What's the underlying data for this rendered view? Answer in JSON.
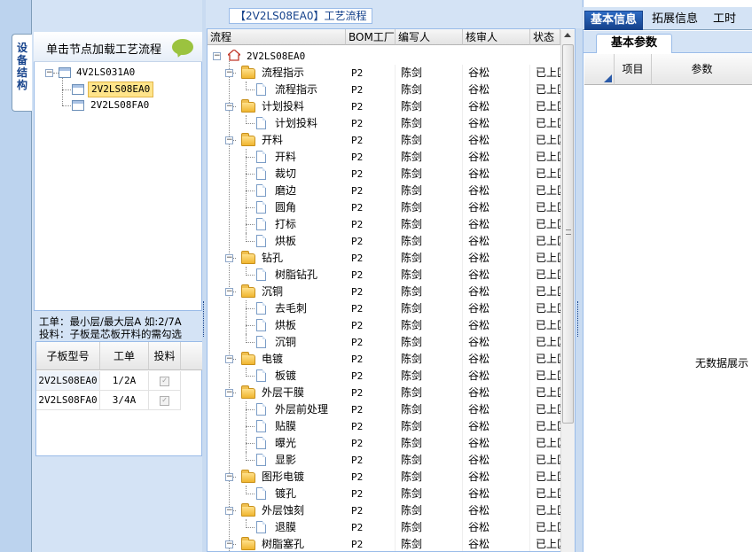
{
  "left_tab": {
    "label": "设备结构"
  },
  "load_hint": "单击节点加载工艺流程",
  "tree": {
    "root": "4V2LS031A0",
    "children": [
      {
        "label": "2V2LS08EA0",
        "selected": true
      },
      {
        "label": "2V2LS08FA0",
        "selected": false
      }
    ]
  },
  "info": {
    "line1": "工单：最小层/最大层A 如:2/7A",
    "line2": "投料：子板是芯板开料的需勾选"
  },
  "sub_table": {
    "headers": [
      "子板型号",
      "工单",
      "投料"
    ],
    "rows": [
      {
        "model": "2V2LS08EA0",
        "order": "1/2A",
        "feed": "✓"
      },
      {
        "model": "2V2LS08FA0",
        "order": "3/4A",
        "feed": "✓"
      }
    ]
  },
  "center": {
    "title": "【2V2LS08EA0】工艺流程",
    "headers": [
      "流程",
      "BOM工厂",
      "编写人",
      "核审人",
      "状态"
    ],
    "root_label": "2V2LS08EA0",
    "rows": [
      {
        "level": 1,
        "name": "流程指示",
        "bom": "P2",
        "writer": "陈剑",
        "reviewer": "谷松",
        "status": "已上区"
      },
      {
        "level": 2,
        "name": "流程指示",
        "bom": "P2",
        "writer": "陈剑",
        "reviewer": "谷松",
        "status": "已上区"
      },
      {
        "level": 1,
        "name": "计划投料",
        "bom": "P2",
        "writer": "陈剑",
        "reviewer": "谷松",
        "status": "已上区"
      },
      {
        "level": 2,
        "name": "计划投料",
        "bom": "P2",
        "writer": "陈剑",
        "reviewer": "谷松",
        "status": "已上区"
      },
      {
        "level": 1,
        "name": "开料",
        "bom": "P2",
        "writer": "陈剑",
        "reviewer": "谷松",
        "status": "已上区"
      },
      {
        "level": 2,
        "name": "开料",
        "bom": "P2",
        "writer": "陈剑",
        "reviewer": "谷松",
        "status": "已上区"
      },
      {
        "level": 2,
        "name": "裁切",
        "bom": "P2",
        "writer": "陈剑",
        "reviewer": "谷松",
        "status": "已上区"
      },
      {
        "level": 2,
        "name": "磨边",
        "bom": "P2",
        "writer": "陈剑",
        "reviewer": "谷松",
        "status": "已上区"
      },
      {
        "level": 2,
        "name": "圆角",
        "bom": "P2",
        "writer": "陈剑",
        "reviewer": "谷松",
        "status": "已上区"
      },
      {
        "level": 2,
        "name": "打标",
        "bom": "P2",
        "writer": "陈剑",
        "reviewer": "谷松",
        "status": "已上区"
      },
      {
        "level": 2,
        "name": "烘板",
        "bom": "P2",
        "writer": "陈剑",
        "reviewer": "谷松",
        "status": "已上区"
      },
      {
        "level": 1,
        "name": "钻孔",
        "bom": "P2",
        "writer": "陈剑",
        "reviewer": "谷松",
        "status": "已上区"
      },
      {
        "level": 2,
        "name": "树脂钻孔",
        "bom": "P2",
        "writer": "陈剑",
        "reviewer": "谷松",
        "status": "已上区"
      },
      {
        "level": 1,
        "name": "沉铜",
        "bom": "P2",
        "writer": "陈剑",
        "reviewer": "谷松",
        "status": "已上区"
      },
      {
        "level": 2,
        "name": "去毛刺",
        "bom": "P2",
        "writer": "陈剑",
        "reviewer": "谷松",
        "status": "已上区"
      },
      {
        "level": 2,
        "name": "烘板",
        "bom": "P2",
        "writer": "陈剑",
        "reviewer": "谷松",
        "status": "已上区"
      },
      {
        "level": 2,
        "name": "沉铜",
        "bom": "P2",
        "writer": "陈剑",
        "reviewer": "谷松",
        "status": "已上区"
      },
      {
        "level": 1,
        "name": "电镀",
        "bom": "P2",
        "writer": "陈剑",
        "reviewer": "谷松",
        "status": "已上区"
      },
      {
        "level": 2,
        "name": "板镀",
        "bom": "P2",
        "writer": "陈剑",
        "reviewer": "谷松",
        "status": "已上区"
      },
      {
        "level": 1,
        "name": "外层干膜",
        "bom": "P2",
        "writer": "陈剑",
        "reviewer": "谷松",
        "status": "已上区"
      },
      {
        "level": 2,
        "name": "外层前处理",
        "bom": "P2",
        "writer": "陈剑",
        "reviewer": "谷松",
        "status": "已上区"
      },
      {
        "level": 2,
        "name": "贴膜",
        "bom": "P2",
        "writer": "陈剑",
        "reviewer": "谷松",
        "status": "已上区"
      },
      {
        "level": 2,
        "name": "曝光",
        "bom": "P2",
        "writer": "陈剑",
        "reviewer": "谷松",
        "status": "已上区"
      },
      {
        "level": 2,
        "name": "显影",
        "bom": "P2",
        "writer": "陈剑",
        "reviewer": "谷松",
        "status": "已上区"
      },
      {
        "level": 1,
        "name": "图形电镀",
        "bom": "P2",
        "writer": "陈剑",
        "reviewer": "谷松",
        "status": "已上区"
      },
      {
        "level": 2,
        "name": "镀孔",
        "bom": "P2",
        "writer": "陈剑",
        "reviewer": "谷松",
        "status": "已上区"
      },
      {
        "level": 1,
        "name": "外层蚀刻",
        "bom": "P2",
        "writer": "陈剑",
        "reviewer": "谷松",
        "status": "已上区"
      },
      {
        "level": 2,
        "name": "退膜",
        "bom": "P2",
        "writer": "陈剑",
        "reviewer": "谷松",
        "status": "已上区"
      },
      {
        "level": 1,
        "name": "树脂塞孔",
        "bom": "P2",
        "writer": "陈剑",
        "reviewer": "谷松",
        "status": "已上区"
      }
    ]
  },
  "right": {
    "tabs": [
      "基本信息",
      "拓展信息",
      "工时"
    ],
    "subtab": "基本参数",
    "headers": [
      "项目",
      "参数"
    ],
    "empty_text": "无数据展示"
  },
  "colors": {
    "accent": "#15428b",
    "panel_bg": "#d4e3f5",
    "border": "#99bbe8",
    "selection": "#ffe48a"
  }
}
